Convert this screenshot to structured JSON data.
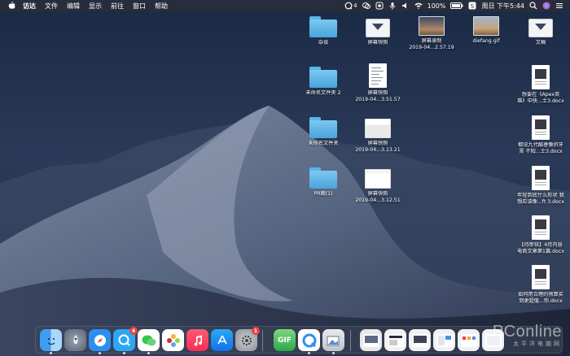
{
  "menubar": {
    "app_name": "访达",
    "items": [
      "文件",
      "编辑",
      "显示",
      "前往",
      "窗口",
      "帮助"
    ],
    "status": {
      "notification_count": "4",
      "battery": "100%",
      "clock": "周日 下午5:44"
    }
  },
  "desktop": {
    "icons": [
      {
        "label": "杂谈"
      },
      {
        "label": "屏幕快照"
      },
      {
        "label": "屏幕录制\n2019-04...2.57.19"
      },
      {
        "label": "diefang.gif"
      },
      {
        "label": "文稿"
      },
      {
        "label": "未命名文件夹 2"
      },
      {
        "label": "屏幕快照\n2019-04...3.51.57"
      },
      {
        "label": "想要在《Apex英\n雄》中快...士3.docx"
      },
      {
        "label": "未命名文件夹"
      },
      {
        "label": "屏幕快照\n2019-04...3.13.21"
      },
      {
        "label": "都说九代酷睿像挤牙\n膏 不知...士3.docx"
      },
      {
        "label": "PR图(1)"
      },
      {
        "label": "屏幕快照\n2019-04...3.12.51"
      },
      {
        "label": "年轻到底什么形状 我\n想应该像...ft 3.docx"
      },
      {
        "label": "【待审核】4月内容\n电商文章第1篇.docx"
      },
      {
        "label": "如何用合理的预算买\n到更超值...你.docx"
      }
    ]
  },
  "dock": {
    "badges": {
      "qq": "4",
      "prefs": "1"
    },
    "gif_label": "GIF"
  },
  "watermark": {
    "brand": "PConline",
    "sub": "太平洋电脑网"
  }
}
